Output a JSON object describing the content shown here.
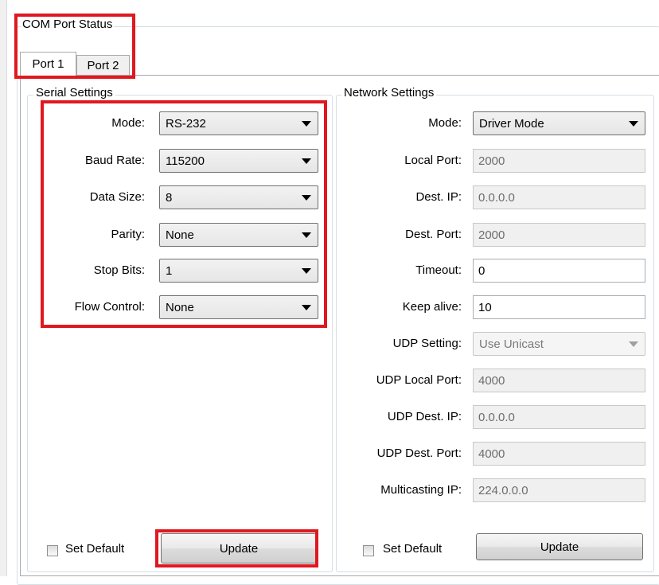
{
  "group_title": "COM Port Status",
  "tabs": [
    {
      "label": "Port 1",
      "active": true
    },
    {
      "label": "Port 2",
      "active": false
    }
  ],
  "serial": {
    "title": "Serial Settings",
    "fields": [
      {
        "label": "Mode:",
        "value": "RS-232"
      },
      {
        "label": "Baud Rate:",
        "value": "115200"
      },
      {
        "label": "Data Size:",
        "value": "8"
      },
      {
        "label": "Parity:",
        "value": "None"
      },
      {
        "label": "Stop Bits:",
        "value": "1"
      },
      {
        "label": "Flow Control:",
        "value": "None"
      }
    ],
    "set_default_label": "Set Default",
    "update_label": "Update"
  },
  "network": {
    "title": "Network Settings",
    "mode": {
      "label": "Mode:",
      "value": "Driver Mode"
    },
    "local_port": {
      "label": "Local Port:",
      "value": "2000"
    },
    "dest_ip": {
      "label": "Dest. IP:",
      "value": "0.0.0.0"
    },
    "dest_port": {
      "label": "Dest. Port:",
      "value": "2000"
    },
    "timeout": {
      "label": "Timeout:",
      "value": "0"
    },
    "keep_alive": {
      "label": "Keep alive:",
      "value": "10"
    },
    "udp_setting": {
      "label": "UDP Setting:",
      "value": "Use Unicast"
    },
    "udp_local_port": {
      "label": "UDP Local Port:",
      "value": "4000"
    },
    "udp_dest_ip": {
      "label": "UDP Dest. IP:",
      "value": "0.0.0.0"
    },
    "udp_dest_port": {
      "label": "UDP Dest. Port:",
      "value": "4000"
    },
    "multicasting_ip": {
      "label": "Multicasting IP:",
      "value": "224.0.0.0"
    },
    "set_default_label": "Set Default",
    "update_label": "Update"
  },
  "colors": {
    "highlight": "#e0181f"
  }
}
